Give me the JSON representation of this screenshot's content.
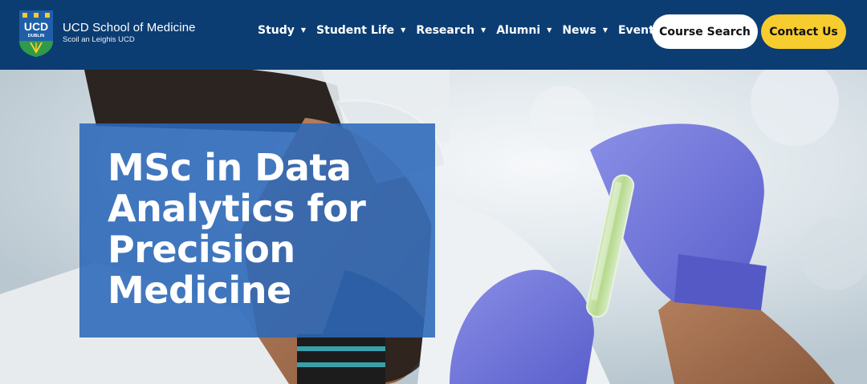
{
  "header": {
    "brand_title": "UCD School of Medicine",
    "brand_subtitle": "Scoil an Leighis UCD",
    "logo_text": "UCD",
    "logo_subtext": "DUBLIN",
    "nav": [
      {
        "label": "Study",
        "has_dropdown": true
      },
      {
        "label": "Student Life",
        "has_dropdown": true
      },
      {
        "label": "Research",
        "has_dropdown": true
      },
      {
        "label": "Alumni",
        "has_dropdown": true
      },
      {
        "label": "News",
        "has_dropdown": true
      },
      {
        "label": "Events",
        "has_dropdown": false
      }
    ],
    "course_search_label": "Course Search",
    "contact_label": "Contact Us"
  },
  "hero": {
    "title": "MSc in Data Analytics for Precision Medicine",
    "image_icon": "scientist-with-test-tube"
  },
  "colors": {
    "header_bg": "#0b3d73",
    "title_box_bg": "#2b68b8",
    "contact_button_bg": "#f7cc2e",
    "glove_purple": "#6f73d9"
  }
}
